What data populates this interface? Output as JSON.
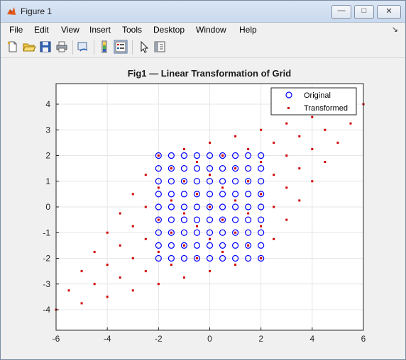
{
  "window": {
    "title": "Figure 1",
    "min_glyph": "—",
    "max_glyph": "□",
    "close_glyph": "✕"
  },
  "menu": {
    "items": [
      "File",
      "Edit",
      "View",
      "Insert",
      "Tools",
      "Desktop",
      "Window",
      "Help"
    ],
    "dock_glyph": "↘"
  },
  "toolbar": {
    "icons": [
      "new-figure-icon",
      "open-file-icon",
      "save-icon",
      "print-icon",
      "link-plot-icon",
      "colorbar-icon",
      "legend-icon",
      "pointer-icon",
      "property-editor-icon"
    ]
  },
  "colors": {
    "original": "#0000ff",
    "transformed": "#d00000",
    "grid": "#e6e6e6",
    "axes": "#262626"
  },
  "chart_data": {
    "type": "scatter",
    "title": "Fig1 — Linear Transformation of Grid",
    "xlabel": "",
    "ylabel": "",
    "xlim": [
      -6,
      6
    ],
    "ylim": [
      -4.8,
      4.8
    ],
    "xticks": [
      -6,
      -4,
      -2,
      0,
      2,
      4,
      6
    ],
    "yticks": [
      -4,
      -3,
      -2,
      -1,
      0,
      1,
      2,
      3,
      4
    ],
    "grid": true,
    "legend": {
      "placement": "top-right",
      "entries": [
        "Original",
        "Transformed"
      ]
    },
    "series": [
      {
        "name": "Original",
        "marker": "circle",
        "grid_x_values": [
          -2,
          -1.5,
          -1,
          -0.5,
          0,
          0.5,
          1,
          1.5,
          2
        ],
        "grid_y_values": [
          -2,
          -1.5,
          -1,
          -0.5,
          0,
          0.5,
          1,
          1.5,
          2
        ]
      },
      {
        "name": "Transformed",
        "marker": "point",
        "matrix": [
          [
            2,
            1
          ],
          [
            0.5,
            1.5
          ]
        ],
        "note_source": "Transformed = matrix × Original grid points"
      }
    ]
  }
}
